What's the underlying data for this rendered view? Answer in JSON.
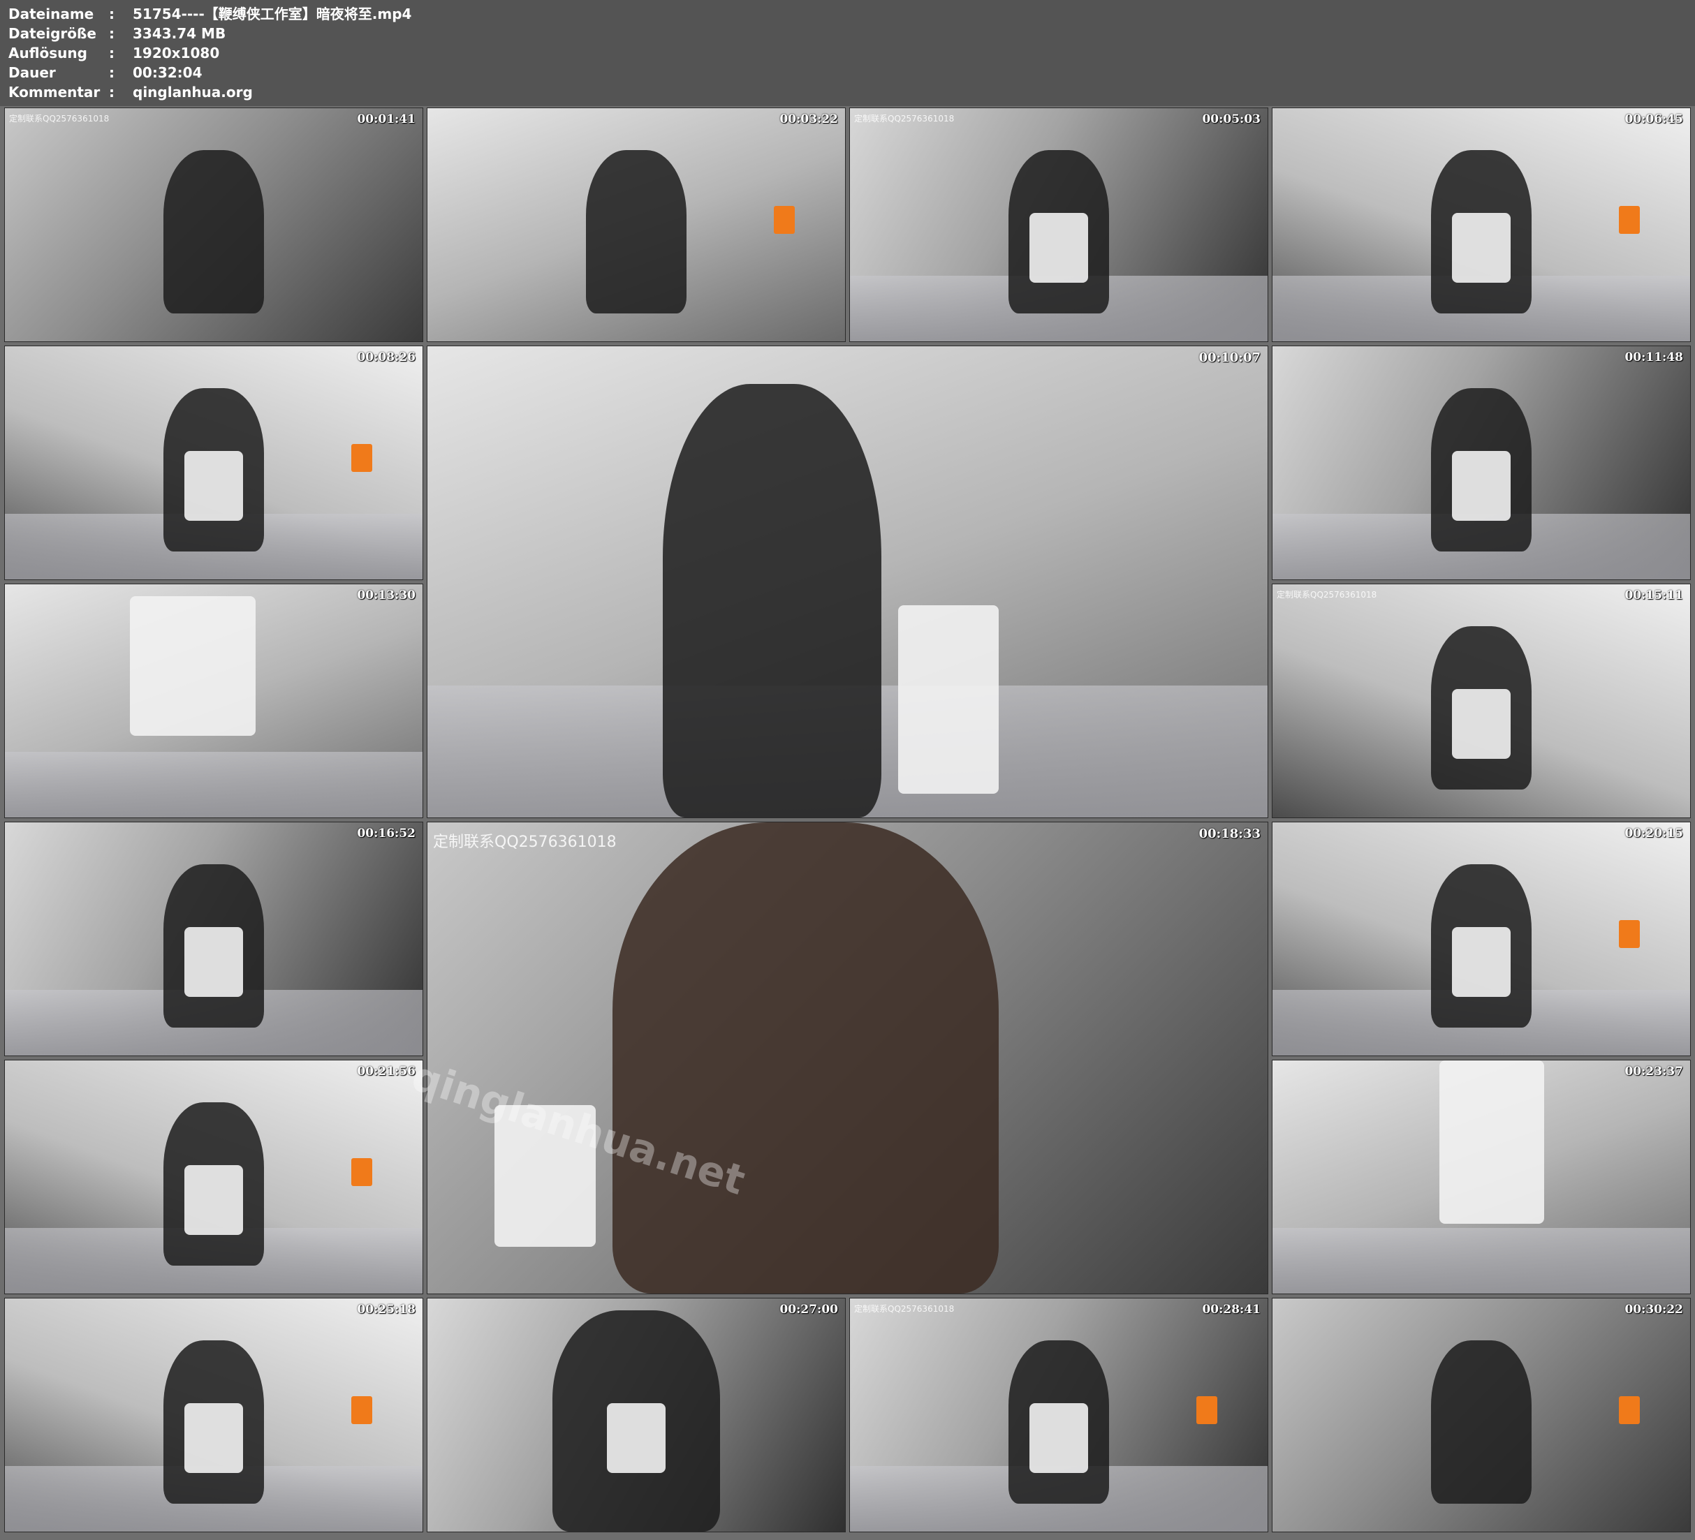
{
  "header": {
    "rows": [
      {
        "label": "Dateiname",
        "sep": ":",
        "value": "51754----【鞭缚侠工作室】暗夜将至.mp4"
      },
      {
        "label": "Dateigröße",
        "sep": ":",
        "value": "3343.74 MB"
      },
      {
        "label": "Auflösung",
        "sep": ":",
        "value": "1920x1080"
      },
      {
        "label": "Dauer",
        "sep": ":",
        "value": "00:32:04"
      },
      {
        "label": "Kommentar",
        "sep": ":",
        "value": "qinglanhua.org"
      }
    ]
  },
  "thumbs": [
    {
      "time": "00:01:41",
      "watermark": "定制联系QQ2576361018"
    },
    {
      "time": "00:03:22",
      "watermark": ""
    },
    {
      "time": "00:05:03",
      "watermark": "定制联系QQ2576361018"
    },
    {
      "time": "00:06:45",
      "watermark": ""
    },
    {
      "time": "00:08:26",
      "watermark": ""
    },
    {
      "time": "00:10:07",
      "watermark": ""
    },
    {
      "time": "00:11:48",
      "watermark": ""
    },
    {
      "time": "00:13:30",
      "watermark": ""
    },
    {
      "time": "00:15:11",
      "watermark": "定制联系QQ2576361018"
    },
    {
      "time": "00:16:52",
      "watermark": ""
    },
    {
      "time": "00:18:33",
      "watermark": "定制联系QQ2576361018"
    },
    {
      "time": "00:20:15",
      "watermark": ""
    },
    {
      "time": "00:21:56",
      "watermark": ""
    },
    {
      "time": "00:23:37",
      "watermark": ""
    },
    {
      "time": "00:25:18",
      "watermark": ""
    },
    {
      "time": "00:27:00",
      "watermark": ""
    },
    {
      "time": "00:28:41",
      "watermark": "定制联系QQ2576361018"
    },
    {
      "time": "00:30:22",
      "watermark": ""
    }
  ],
  "site_watermark": "qinglanhua.net",
  "colors": {
    "header_bg": "#545454",
    "page_bg": "#6e6e6e",
    "text": "#ffffff",
    "accent_orange": "#f07a1a"
  }
}
